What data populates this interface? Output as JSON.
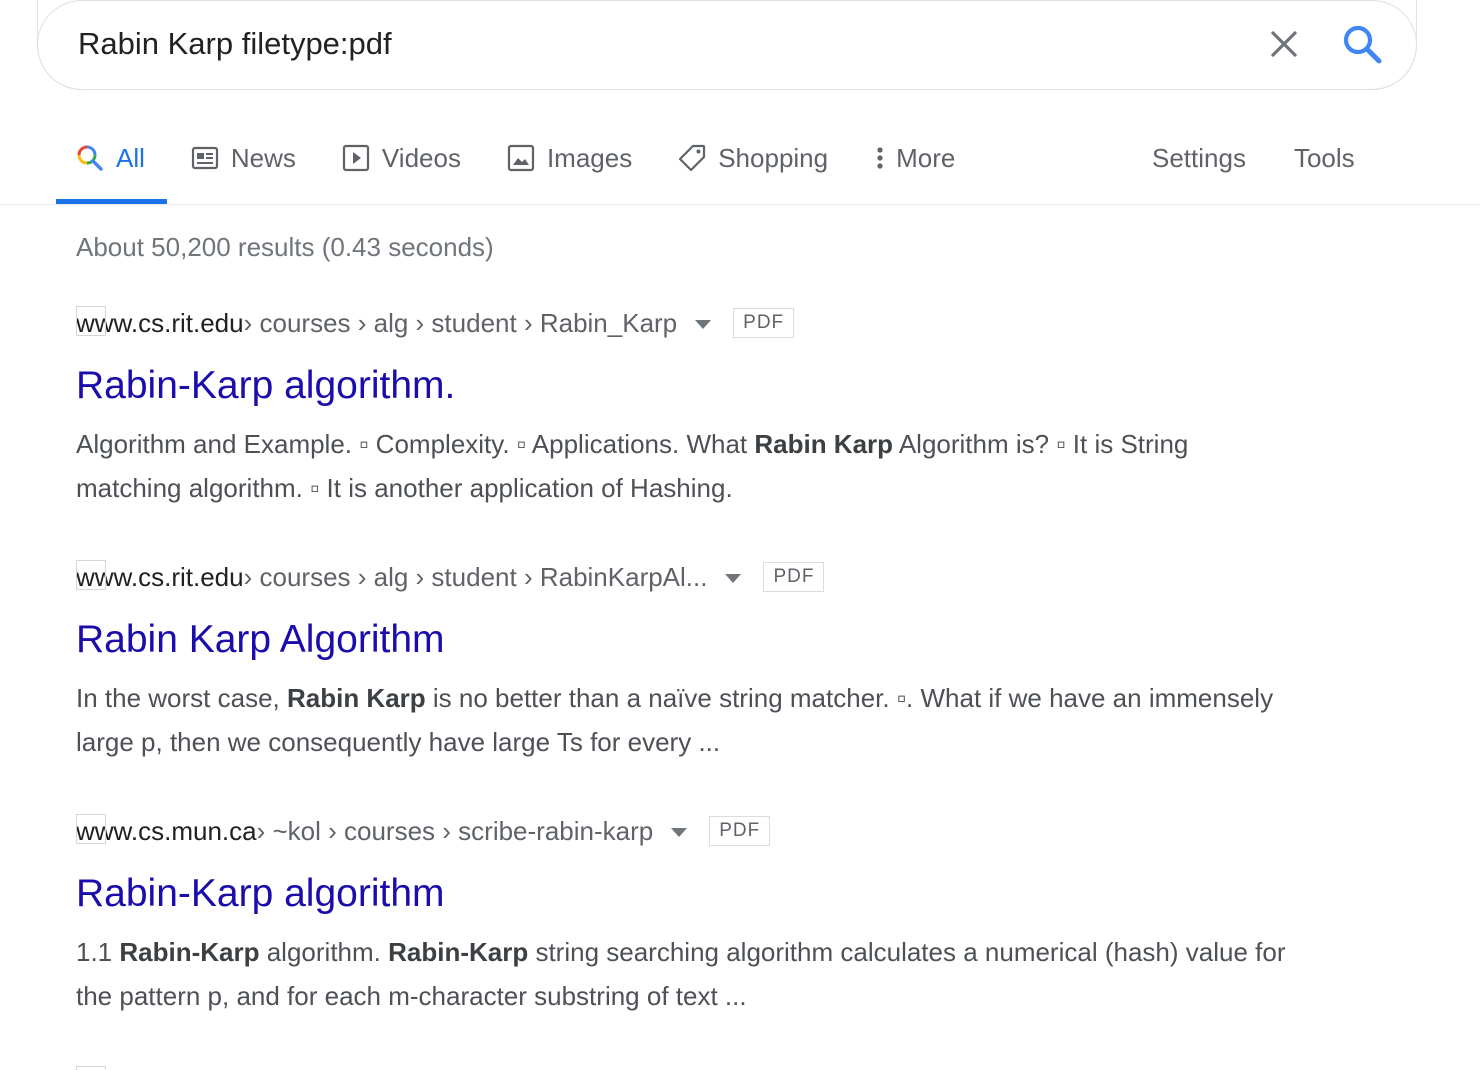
{
  "search": {
    "query": "Rabin Karp filetype:pdf",
    "clear_icon": "close-icon",
    "search_icon": "search-icon"
  },
  "tabs": [
    {
      "label": "All",
      "icon": "google-search-icon",
      "active": true
    },
    {
      "label": "News",
      "icon": "news-icon",
      "active": false
    },
    {
      "label": "Videos",
      "icon": "video-play-icon",
      "active": false
    },
    {
      "label": "Images",
      "icon": "image-icon",
      "active": false
    },
    {
      "label": "Shopping",
      "icon": "tag-icon",
      "active": false
    },
    {
      "label": "More",
      "icon": "vertical-dots-icon",
      "active": false
    }
  ],
  "tools": {
    "settings_label": "Settings",
    "tools_label": "Tools"
  },
  "stats": "About 50,200 results (0.43 seconds)",
  "results": [
    {
      "domain": "www.cs.rit.edu",
      "path": " › courses › alg › student › Rabin_Karp",
      "badge": "PDF",
      "title": "Rabin-Karp algorithm.",
      "snippet_parts": [
        {
          "text": "Algorithm and Example. ▫ Complexity. ▫ Applications. What ",
          "bold": false
        },
        {
          "text": "Rabin Karp",
          "bold": true
        },
        {
          "text": " Algorithm is? ▫ It is String matching algorithm. ▫ It is another application of Hashing.",
          "bold": false
        }
      ]
    },
    {
      "domain": "www.cs.rit.edu",
      "path": " › courses › alg › student › RabinKarpAl...",
      "badge": "PDF",
      "title": "Rabin Karp Algorithm",
      "snippet_parts": [
        {
          "text": "In the worst case, ",
          "bold": false
        },
        {
          "text": "Rabin Karp",
          "bold": true
        },
        {
          "text": " is no better than a naïve string matcher. ▫. What if we have an immensely large p, then we consequently have large Ts for every ...",
          "bold": false
        }
      ]
    },
    {
      "domain": "www.cs.mun.ca",
      "path": " › ~kol › courses › scribe-rabin-karp",
      "badge": "PDF",
      "title": "Rabin-Karp algorithm",
      "snippet_parts": [
        {
          "text": "1.1 ",
          "bold": false
        },
        {
          "text": "Rabin-Karp",
          "bold": true
        },
        {
          "text": " algorithm. ",
          "bold": false
        },
        {
          "text": "Rabin-Karp",
          "bold": true
        },
        {
          "text": " string searching algorithm calculates a numerical (hash) value for the pattern p, and for each m-character substring of text ...",
          "bold": false
        }
      ]
    }
  ]
}
